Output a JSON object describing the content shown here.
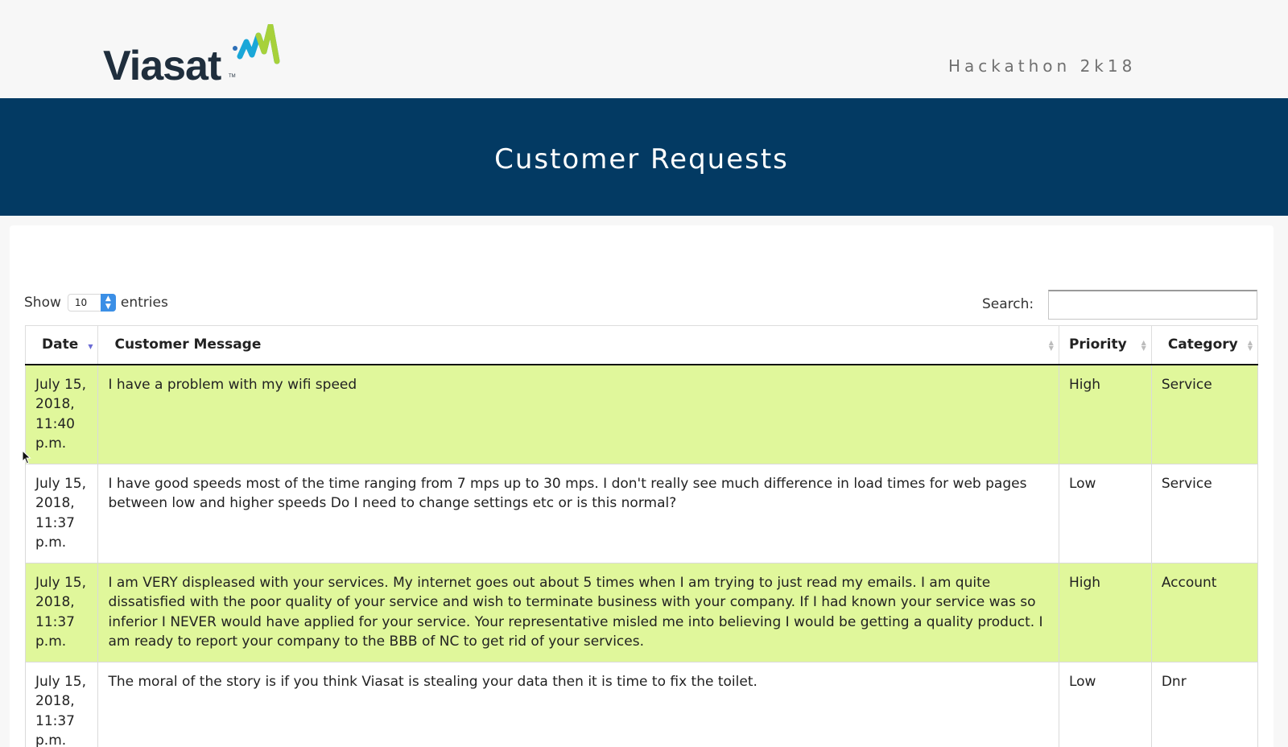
{
  "header": {
    "logo_text": "Viasat",
    "logo_tm": "TM",
    "tagline": "Hackathon 2k18"
  },
  "banner": {
    "title": "Customer Requests"
  },
  "controls": {
    "show_label": "Show",
    "entries_value": "10",
    "entries_label": "entries",
    "search_label": "Search:",
    "search_value": ""
  },
  "table": {
    "columns": [
      {
        "label": "Date",
        "sort": "desc"
      },
      {
        "label": "Customer Message",
        "sort": "none"
      },
      {
        "label": "Priority",
        "sort": "none"
      },
      {
        "label": "Category",
        "sort": "none"
      }
    ],
    "rows": [
      {
        "date": "July 15, 2018, 11:40 p.m.",
        "message": "I have a problem with my wifi speed",
        "priority": "High",
        "category": "Service"
      },
      {
        "date": "July 15, 2018, 11:37 p.m.",
        "message": "I have good speeds most of the time ranging from 7 mps up to 30 mps. I don't really see much difference in load times for web pages between low and higher speeds Do I need to change settings etc or is this normal?",
        "priority": "Low",
        "category": "Service"
      },
      {
        "date": "July 15, 2018, 11:37 p.m.",
        "message": "I am VERY displeased with your services. My internet goes out about 5 times when I am trying to just read my emails. I am quite dissatisfied with the poor quality of your service and wish to terminate business with your company. If I had known your service was so inferior I NEVER would have applied for your service. Your representative misled me into believing I would be getting a quality product. I am ready to report your company to the BBB of NC to get rid of your services.",
        "priority": "High",
        "category": "Account"
      },
      {
        "date": "July 15, 2018, 11:37 p.m.",
        "message": "The moral of the story is if you think Viasat is stealing your data then it is time to fix the toilet.",
        "priority": "Low",
        "category": "Dnr"
      }
    ]
  },
  "colors": {
    "banner": "#033a63",
    "highlight_row": "#e0f79b",
    "logo_text": "#1f2e3d",
    "logo_mark_blue": "#1aa7d8",
    "logo_mark_green": "#a7d13a"
  },
  "icons": {
    "logo_mark": "viasat-wave-icon",
    "select_arrows": "updown-chevron-icon",
    "sort_desc": "sort-desc-icon",
    "sort_both": "sort-both-icon",
    "cursor": "mouse-pointer-icon"
  }
}
